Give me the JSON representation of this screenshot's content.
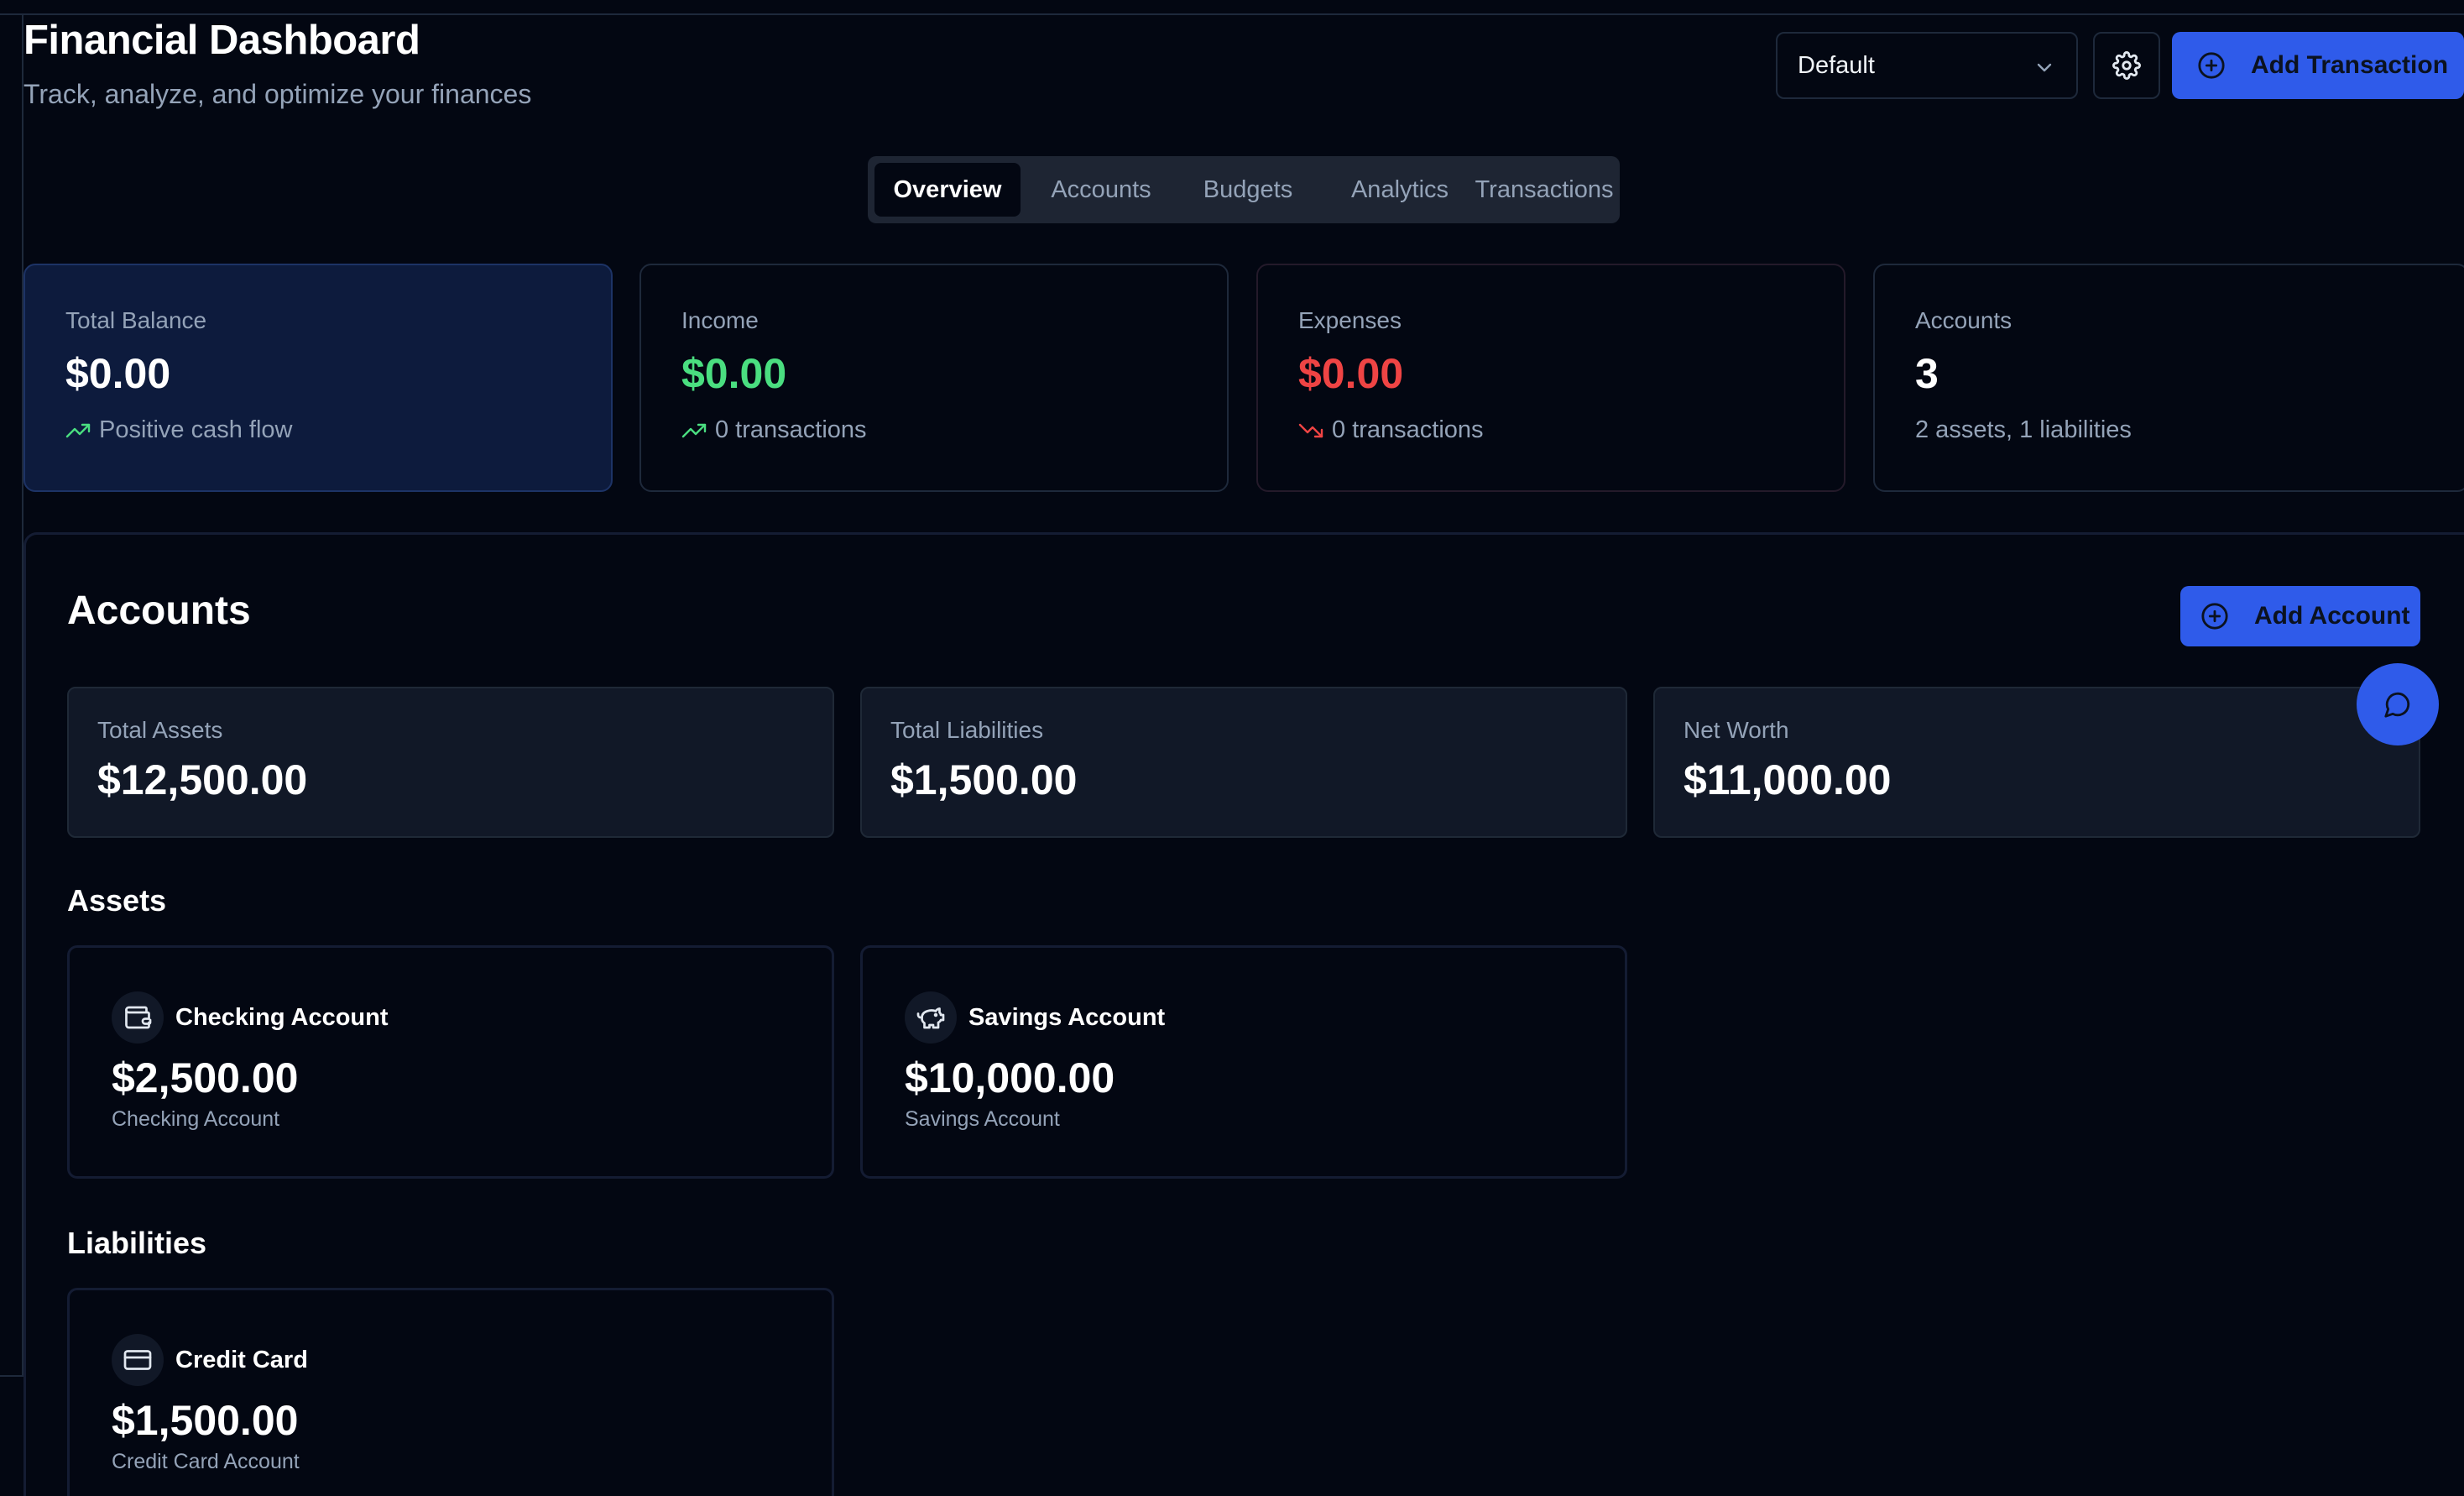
{
  "header": {
    "title": "Financial Dashboard",
    "subtitle": "Track, analyze, and optimize your finances",
    "profile_select": {
      "value": "Default"
    },
    "add_transaction_label": "Add Transaction"
  },
  "tabs": [
    {
      "label": "Overview",
      "active": true
    },
    {
      "label": "Accounts",
      "active": false
    },
    {
      "label": "Budgets",
      "active": false
    },
    {
      "label": "Analytics",
      "active": false
    },
    {
      "label": "Transactions",
      "active": false
    }
  ],
  "stats": {
    "balance": {
      "label": "Total Balance",
      "value": "$0.00",
      "sub": "Positive cash flow"
    },
    "income": {
      "label": "Income",
      "value": "$0.00",
      "sub": "0 transactions"
    },
    "expenses": {
      "label": "Expenses",
      "value": "$0.00",
      "sub": "0 transactions"
    },
    "accounts": {
      "label": "Accounts",
      "value": "3",
      "sub": "2 assets, 1 liabilities"
    }
  },
  "accounts_panel": {
    "title": "Accounts",
    "add_account_label": "Add Account",
    "summary": {
      "assets": {
        "label": "Total Assets",
        "value": "$12,500.00"
      },
      "liabilities": {
        "label": "Total Liabilities",
        "value": "$1,500.00"
      },
      "net_worth": {
        "label": "Net Worth",
        "value": "$11,000.00"
      }
    },
    "assets_title": "Assets",
    "assets": [
      {
        "name": "Checking Account",
        "value": "$2,500.00",
        "type": "Checking Account",
        "icon": "wallet-icon"
      },
      {
        "name": "Savings Account",
        "value": "$10,000.00",
        "type": "Savings Account",
        "icon": "piggy-bank-icon"
      }
    ],
    "liabilities_title": "Liabilities",
    "liabilities": [
      {
        "name": "Credit Card",
        "value": "$1,500.00",
        "type": "Credit Card Account",
        "icon": "credit-card-icon"
      }
    ]
  },
  "colors": {
    "background": "#030712",
    "accent": "#2f5bea",
    "positive": "#4ade80",
    "negative": "#ef4444",
    "muted_text": "#94a3b8"
  }
}
